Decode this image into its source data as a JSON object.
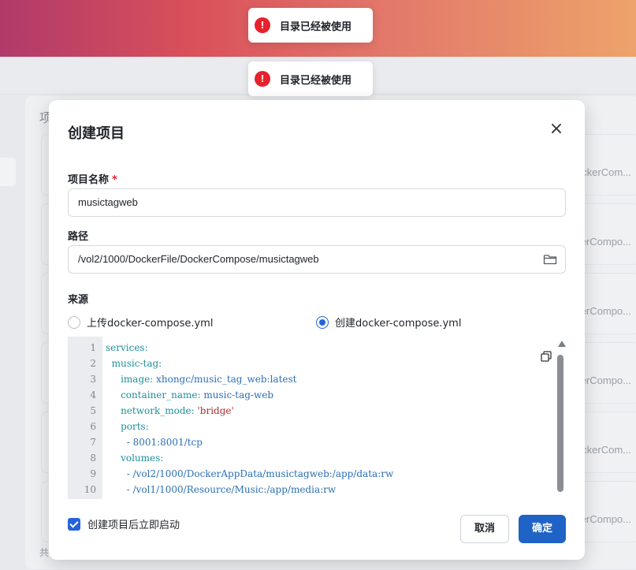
{
  "toasts": [
    {
      "message": "目录已经被使用"
    },
    {
      "message": "目录已经被使用"
    }
  ],
  "background": {
    "heading": "项",
    "card_text": "ckerCom...",
    "card_text_2": "ckerCompo...",
    "card_text_3": "ckerCompo...",
    "card_text_4": "ckerCompo...",
    "card_text_5": "ckerCom...",
    "card_text_6": "ckerCompo...",
    "footer": "共"
  },
  "dialog": {
    "title": "创建项目",
    "close_symbol": "×",
    "name_label": "项目名称",
    "required_mark": "*",
    "name_value": "musictagweb",
    "path_label": "路径",
    "path_value": "/vol2/1000/DockerFile/DockerCompose/musictagweb",
    "source_label": "来源",
    "source_options": [
      {
        "label": "上传docker-compose.yml",
        "selected": false
      },
      {
        "label": "创建docker-compose.yml",
        "selected": true
      }
    ],
    "code_lines": [
      {
        "n": "1",
        "indent": "",
        "key": "services:",
        "value": "",
        "value_type": ""
      },
      {
        "n": "2",
        "indent": "  ",
        "key": "music-tag:",
        "value": "",
        "value_type": ""
      },
      {
        "n": "3",
        "indent": "     ",
        "key": "image:",
        "value": " xhongc/music_tag_web:latest",
        "value_type": "v"
      },
      {
        "n": "4",
        "indent": "     ",
        "key": "container_name:",
        "value": " music-tag-web",
        "value_type": "v"
      },
      {
        "n": "5",
        "indent": "     ",
        "key": "network_mode:",
        "value": " 'bridge'",
        "value_type": "s"
      },
      {
        "n": "6",
        "indent": "     ",
        "key": "ports:",
        "value": "",
        "value_type": ""
      },
      {
        "n": "7",
        "indent": "       ",
        "key": "",
        "value": "- 8001:8001/tcp",
        "value_type": "v"
      },
      {
        "n": "8",
        "indent": "     ",
        "key": "volumes:",
        "value": "",
        "value_type": ""
      },
      {
        "n": "9",
        "indent": "       ",
        "key": "",
        "value": "- /vol2/1000/DockerAppData/musictagweb:/app/data:rw",
        "value_type": "v"
      },
      {
        "n": "10",
        "indent": "       ",
        "key": "",
        "value": "- /vol1/1000/Resource/Music:/app/media:rw",
        "value_type": "v"
      }
    ],
    "autostart_label": "创建项目后立即启动",
    "autostart_checked": true,
    "cancel_label": "取消",
    "ok_label": "确定"
  },
  "colors": {
    "accent": "#2563d8",
    "primary_button": "#1f63c6",
    "error": "#e5222e",
    "yaml_key": "#1f8f9a",
    "yaml_value": "#2b6fb5",
    "yaml_string": "#b22c2c"
  },
  "icons": {
    "error": "exclamation-circle-icon",
    "close": "close-icon",
    "folder": "folder-icon",
    "copy": "copy-icon"
  }
}
